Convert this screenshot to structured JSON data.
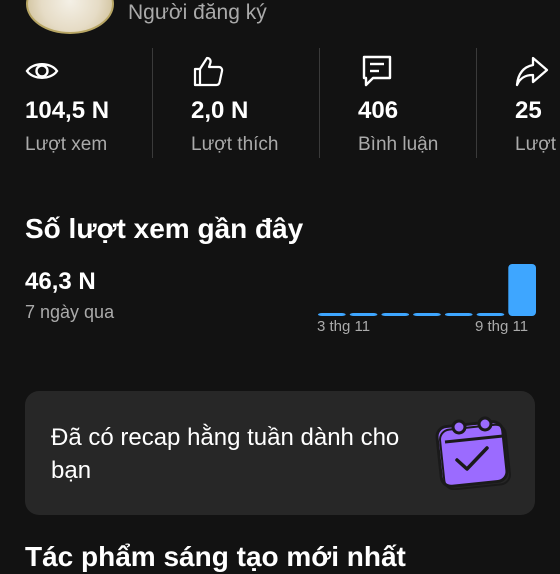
{
  "header": {
    "subscribers_label": "Người đăng ký"
  },
  "stats": [
    {
      "icon": "eye-icon",
      "value": "104,5 N",
      "label": "Lượt xem"
    },
    {
      "icon": "thumbs-up-icon",
      "value": "2,0 N",
      "label": "Lượt thích"
    },
    {
      "icon": "comment-icon",
      "value": "406",
      "label": "Bình luận"
    },
    {
      "icon": "share-icon",
      "value": "25",
      "label": "Lượt"
    }
  ],
  "recent_views": {
    "title": "Số lượt xem gần đây",
    "value": "46,3 N",
    "period": "7 ngày qua"
  },
  "chart_data": {
    "type": "bar",
    "categories": [
      "3 thg 11",
      "",
      "",
      "",
      "",
      "",
      "9 thg 11"
    ],
    "values": [
      0.4,
      1.2,
      1.0,
      1.0,
      1.2,
      1.0,
      39.5
    ],
    "x_tick_labels": [
      "3 thg 11",
      "9 thg 11"
    ],
    "bar_color": "#3ea6ff",
    "grid": false
  },
  "recap": {
    "text": "Đã có recap hằng tuần dành cho bạn",
    "icon": "calendar-check-icon"
  },
  "latest": {
    "title": "Tác phẩm sáng tạo mới nhất"
  },
  "colors": {
    "background": "#121212",
    "card": "#272727",
    "accent": "#3ea6ff",
    "muted": "#aaaaaa"
  }
}
